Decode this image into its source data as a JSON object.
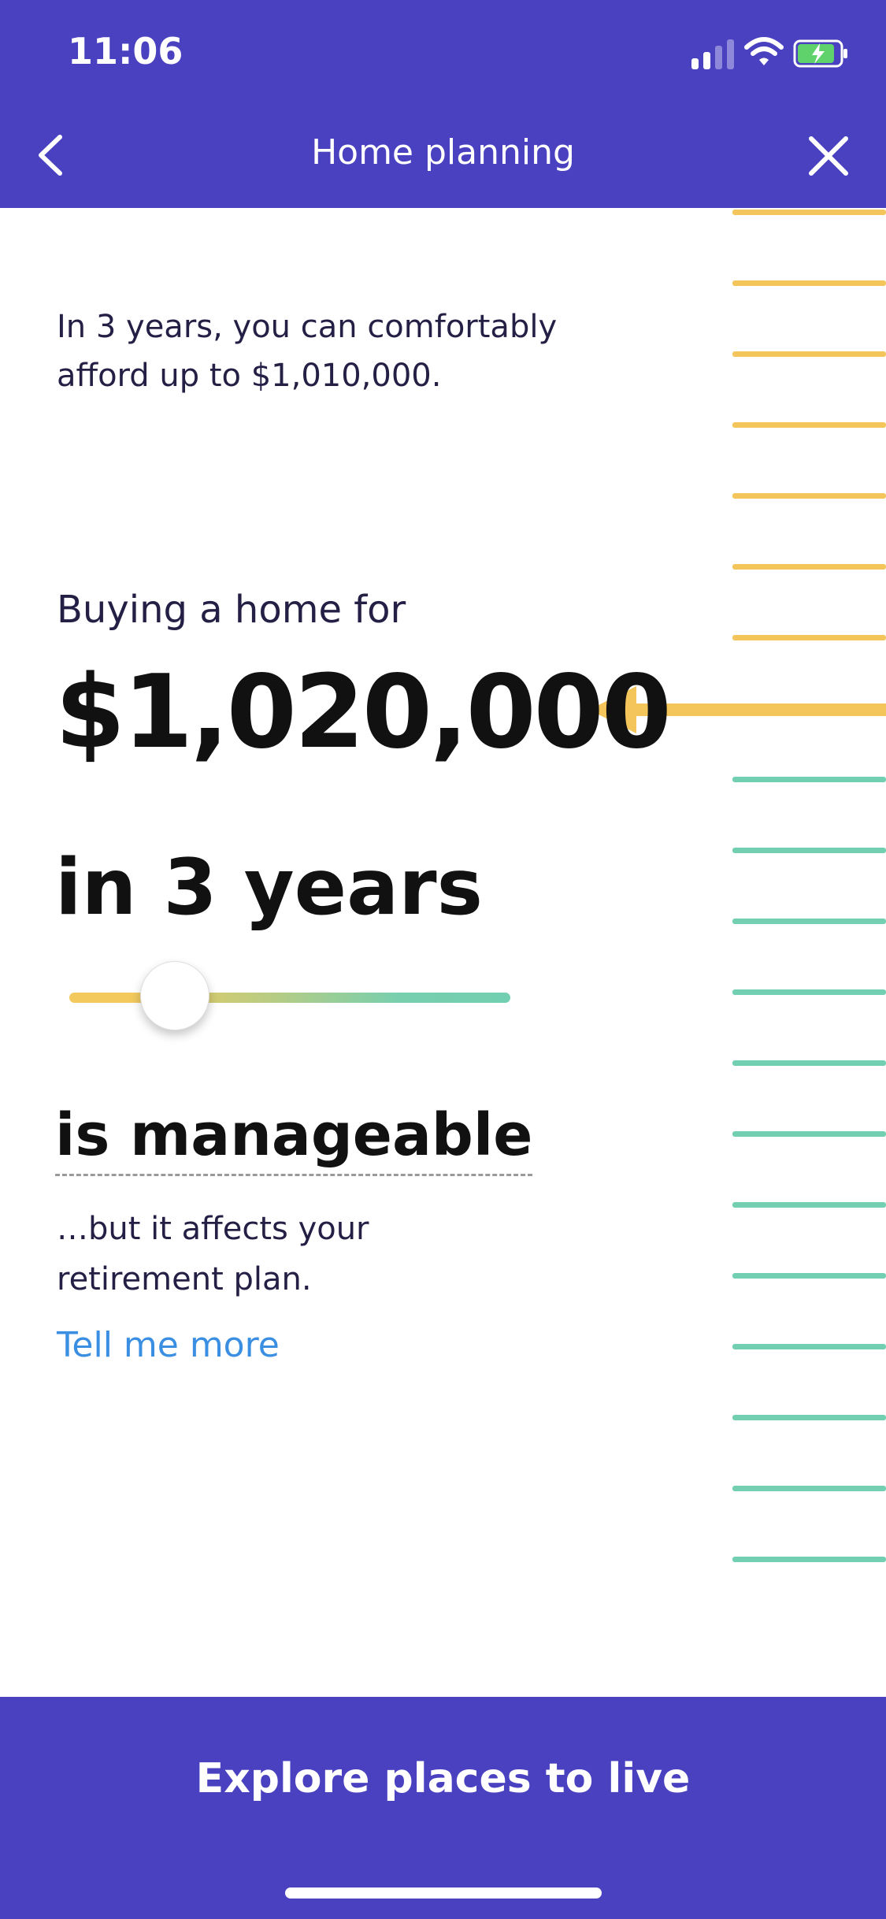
{
  "status_bar": {
    "time": "11:06"
  },
  "header": {
    "title": "Home planning"
  },
  "content": {
    "intro": "In 3 years, you can comfortably afford up to $1,010,000.",
    "buying_label": "Buying a home for",
    "price": "$1,020,000",
    "timeframe": "in 3 years",
    "slider": {
      "value_fraction": 0.16
    },
    "verdict": "is manageable",
    "subtext": "…but it affects your retirement plan.",
    "link": "Tell me more"
  },
  "footer": {
    "cta": "Explore places to live"
  },
  "colors": {
    "brand": "#4a41c1",
    "affordable_tick": "#f4c55a",
    "stretch_tick": "#72cfb1",
    "link": "#3b8fe3"
  }
}
